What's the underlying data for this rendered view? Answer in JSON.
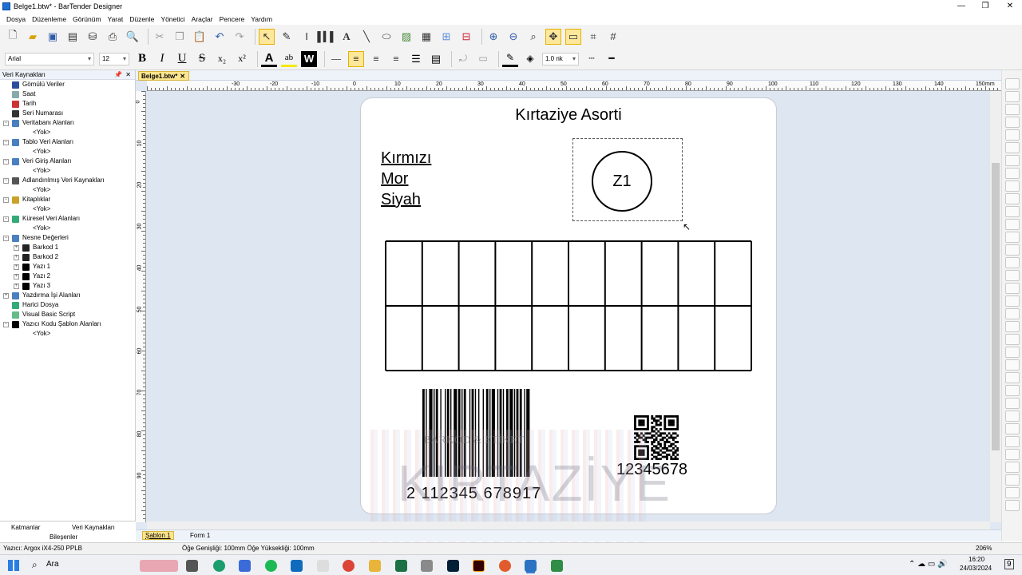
{
  "window": {
    "title": "Belge1.btw* - BarTender Designer",
    "controls": [
      "—",
      "❐",
      "✕"
    ]
  },
  "menu": [
    "Dosya",
    "Düzenleme",
    "Görünüm",
    "Yarat",
    "Düzenle",
    "Yönetici",
    "Araçlar",
    "Pencere",
    "Yardım"
  ],
  "format": {
    "font": "Arial",
    "size": "12",
    "line_width": "1.0 nk"
  },
  "left_panel": {
    "title": "Veri Kaynakları",
    "tree": [
      "Gömülü Veriler",
      "Saat",
      "Tarih",
      "Seri Numarası",
      "Veritabanı Alanları",
      "<Yok>",
      "Tablo Veri Alanları",
      "<Yok>",
      "Veri Giriş Alanları",
      "<Yok>",
      "Adlandırılmış Veri Kaynakları",
      "<Yok>",
      "Kitaplıklar",
      "<Yok>",
      "Küresel Veri Alanları",
      "<Yok>",
      "Nesne Değerleri",
      "Barkod 1",
      "Barkod 2",
      "Yazı 1",
      "Yazı 2",
      "Yazı 3",
      "Yazdırma İşi Alanları",
      "Harici Dosya",
      "Visual Basic Script",
      "Yazıcı Kodu Şablon Alanları",
      "<Yok>"
    ],
    "tabs": {
      "layers": "Katmanlar",
      "data_sources": "Veri Kaynakları",
      "components": "Bileşenler"
    }
  },
  "doc_tab": "Belge1.btw*",
  "ruler": {
    "h": [
      "-30",
      "-20",
      "-10",
      "0",
      "10",
      "20",
      "30",
      "40",
      "50",
      "60",
      "70",
      "80",
      "90",
      "100",
      "110",
      "120",
      "130",
      "140",
      "150"
    ],
    "h_unit": "mm",
    "v": [
      "0",
      "10",
      "20",
      "30",
      "40",
      "50",
      "60",
      "70",
      "80",
      "90"
    ]
  },
  "label": {
    "title": "Kırtaziye Asorti",
    "colors": [
      "Kırmızı",
      "Mor",
      "Siyah"
    ],
    "circle_text": "Z1",
    "barcode_text": "2 112345 678917",
    "qr_text": "12345678",
    "watermark": {
      "top": "BARKOD & ETİKET",
      "middle": "KIRTAZİYE",
      "bottom": "OFİS MALZEMELERİ"
    }
  },
  "bottom_tabs": [
    "Şablon 1",
    "Form 1"
  ],
  "status": {
    "printer": "Yazıcı: Argox iX4-250 PPLB",
    "size": "Öğe Genişliği: 100mm  Öğe Yüksekliği: 100mm",
    "zoom": "206%"
  },
  "taskbar": {
    "search": "Ara",
    "time": "16:20",
    "date": "24/03/2024",
    "notif": "9"
  }
}
